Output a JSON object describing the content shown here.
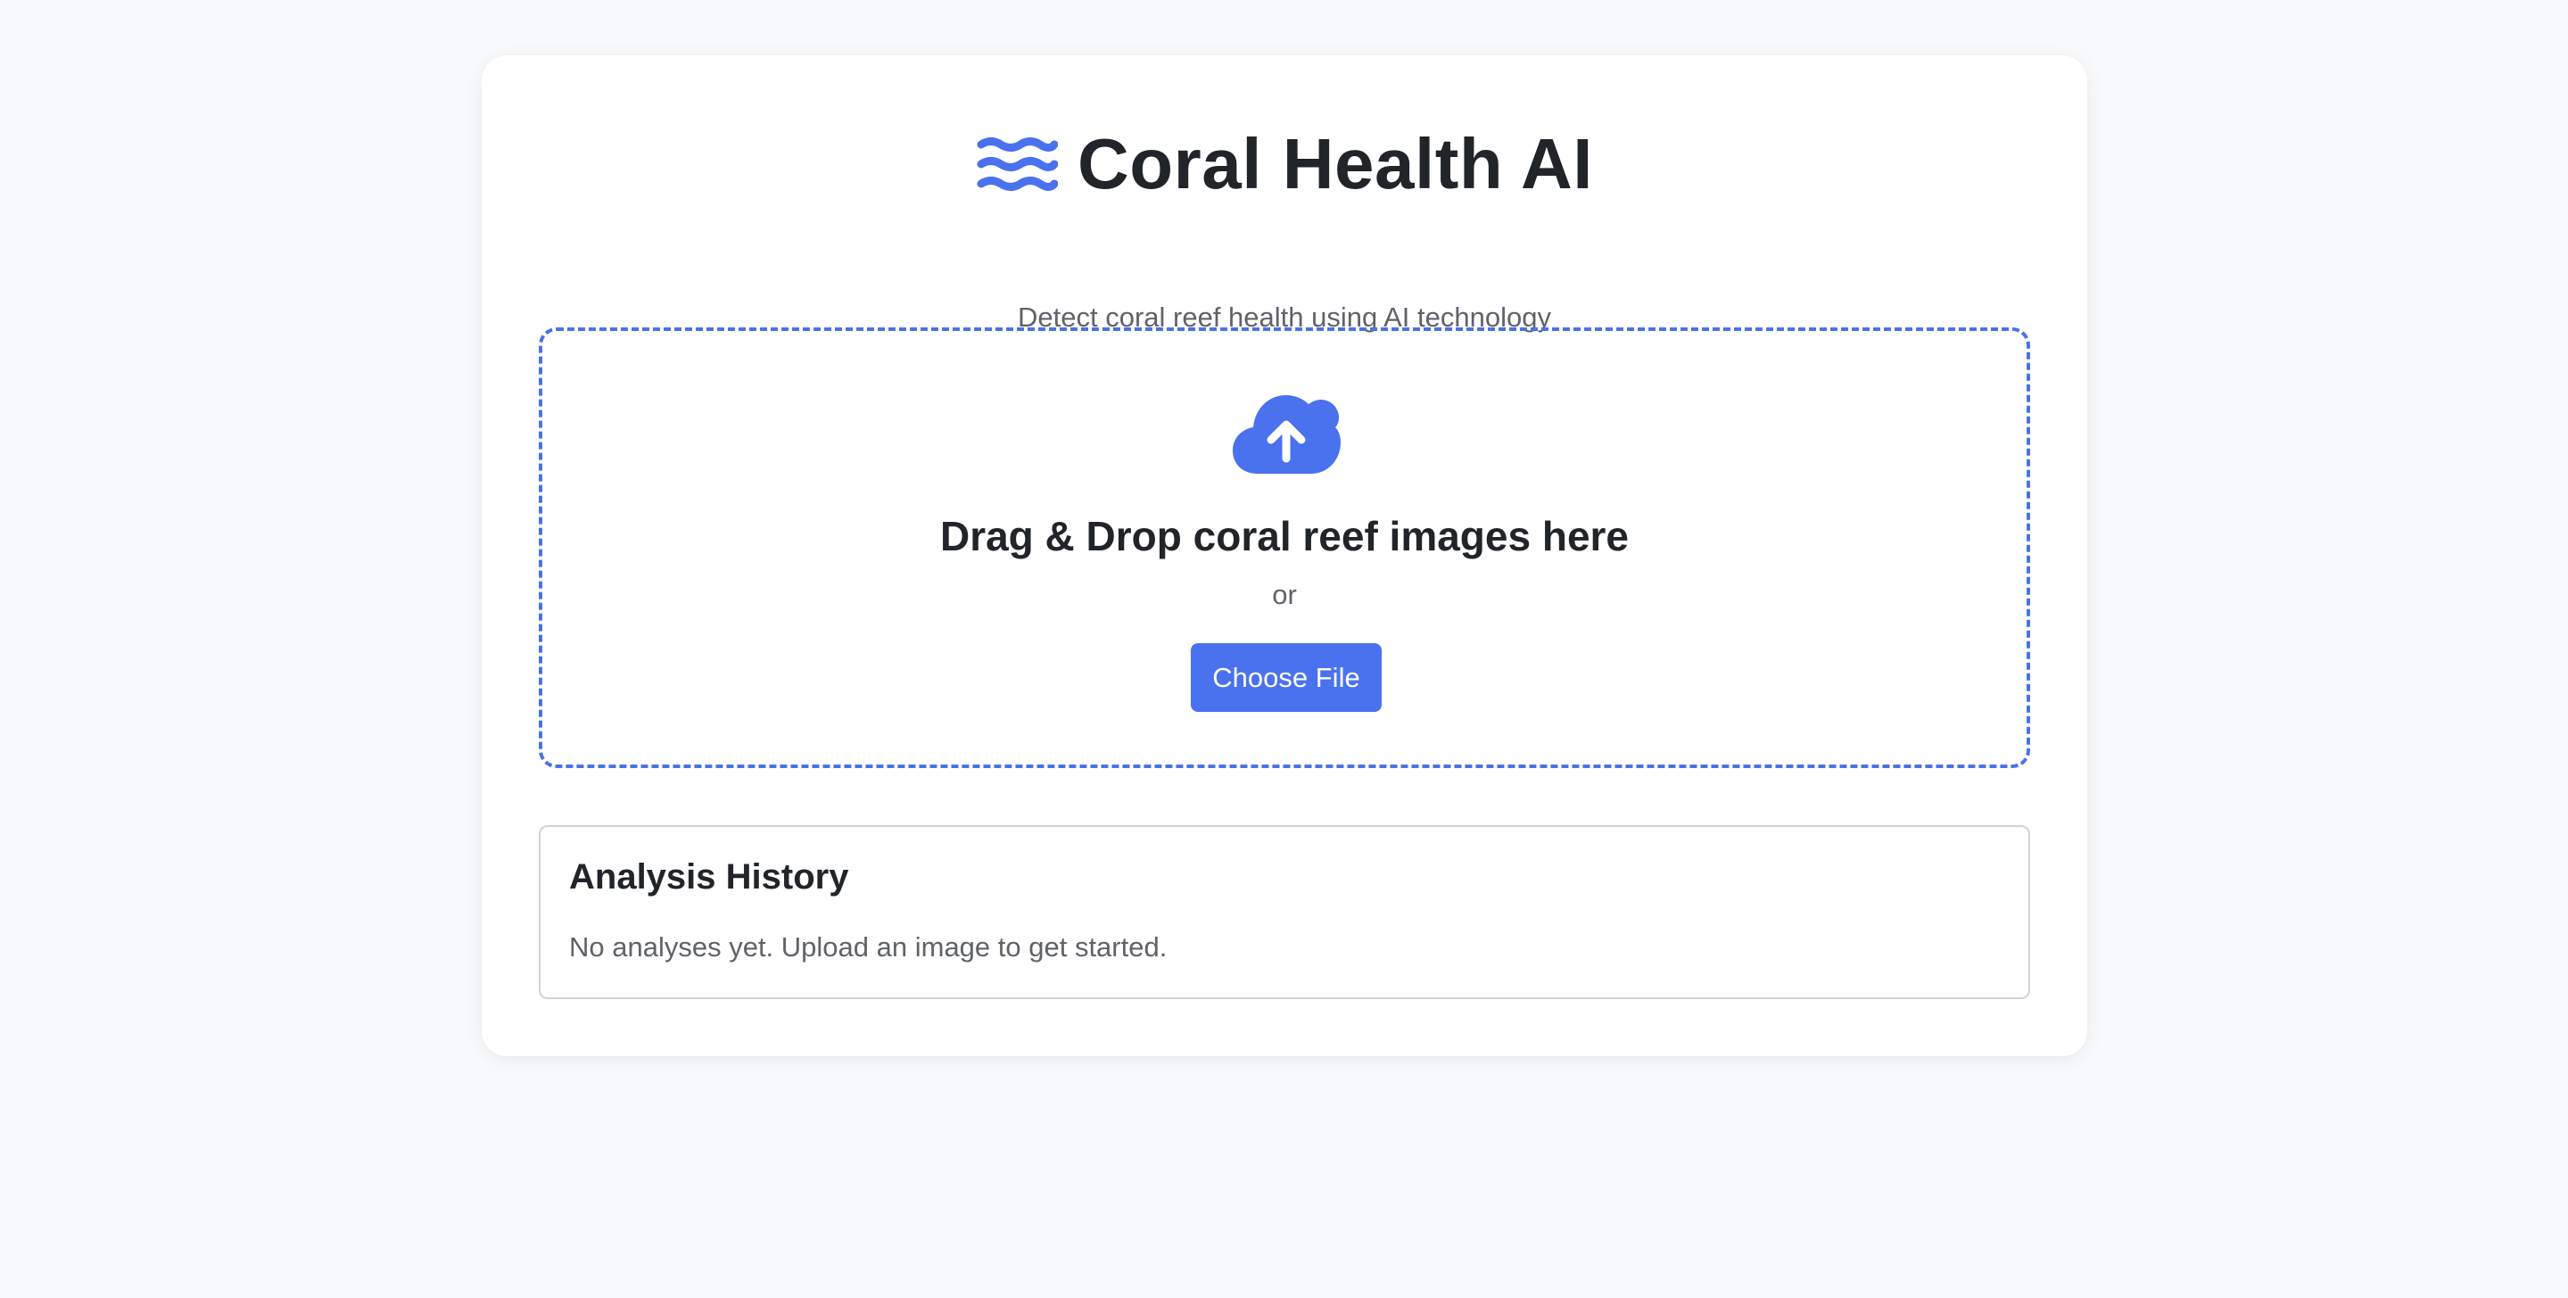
{
  "header": {
    "logo_icon": "water-waves-icon",
    "title": "Coral Health AI",
    "subtitle": "Detect coral reef health using AI technology"
  },
  "upload": {
    "icon": "cloud-upload-icon",
    "title": "Drag & Drop coral reef images here",
    "or_text": "or",
    "button_label": "Choose File"
  },
  "history": {
    "title": "Analysis History",
    "empty_message": "No analyses yet. Upload an image to get started."
  },
  "colors": {
    "accent": "#4a72ef",
    "dropzone_border": "#4a72e8",
    "page_background": "#f8f9fb",
    "card_background": "#ffffff",
    "text_primary": "#212529",
    "text_secondary": "#5f6368"
  }
}
